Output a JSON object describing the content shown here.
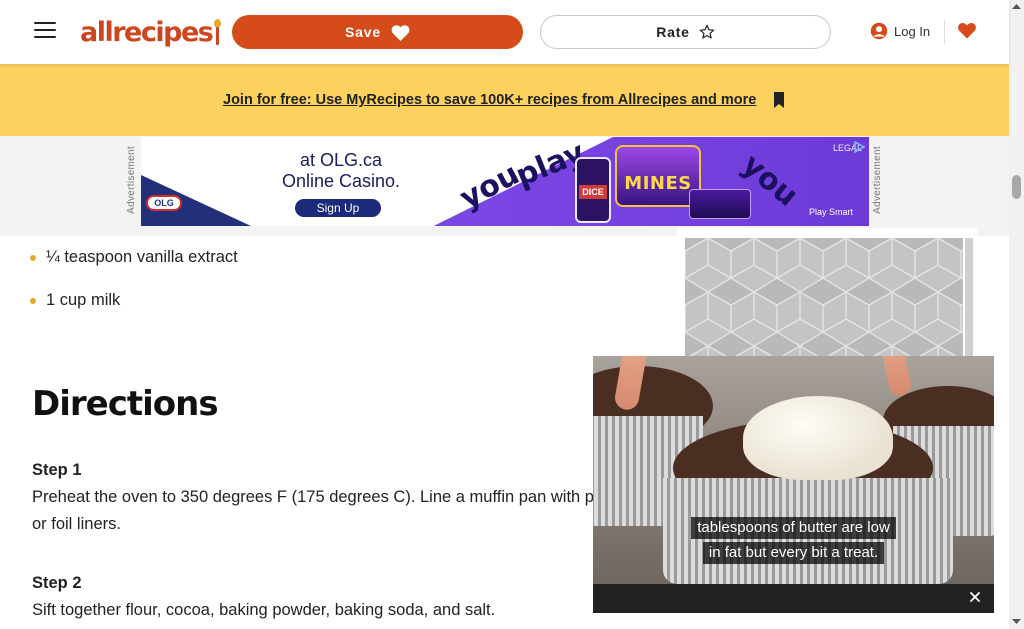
{
  "header": {
    "menu_icon": "hamburger-menu-icon",
    "logo_text": "allrecipes",
    "save_label": "Save",
    "save_icon": "heart-icon",
    "rate_label": "Rate",
    "rate_icon": "star-icon",
    "login_label": "Log In",
    "login_icon": "user-icon",
    "favorites_icon": "heart-icon",
    "accent_color": "#d54b1a"
  },
  "promo": {
    "text": "Join for free: Use MyRecipes to save 100K+ recipes from Allrecipes and more",
    "close_icon": "close-icon",
    "background": "#fcd15d"
  },
  "advertisement": {
    "label": "Advertisement",
    "brand": "OLG",
    "headline_1": "at OLG.ca",
    "headline_2": "Online Casino.",
    "cta": "Sign Up",
    "word_1": "you",
    "word_2": "play",
    "word_3": "you",
    "game_1": "DICE",
    "game_2": "MINES",
    "legal": "LEGAL",
    "play_smart": "Play Smart"
  },
  "ingredients": [
    {
      "text": "¼ teaspoon vanilla extract"
    },
    {
      "text": "1 cup milk"
    }
  ],
  "directions": {
    "title": "Directions",
    "steps": [
      {
        "label": "Step 1",
        "text": "Preheat the oven to 350 degrees F (175 degrees C). Line a muffin pan with paper or foil liners."
      },
      {
        "label": "Step 2",
        "text": "Sift together flour, cocoa, baking powder, baking soda, and salt."
      }
    ]
  },
  "video": {
    "caption_line_1": "tablespoons of butter are low",
    "caption_line_2": "in fat but every bit a treat.",
    "close_icon": "close-icon"
  },
  "scrollbar": {
    "up_icon": "scroll-up-arrow-icon",
    "down_icon": "scroll-down-arrow-icon"
  }
}
